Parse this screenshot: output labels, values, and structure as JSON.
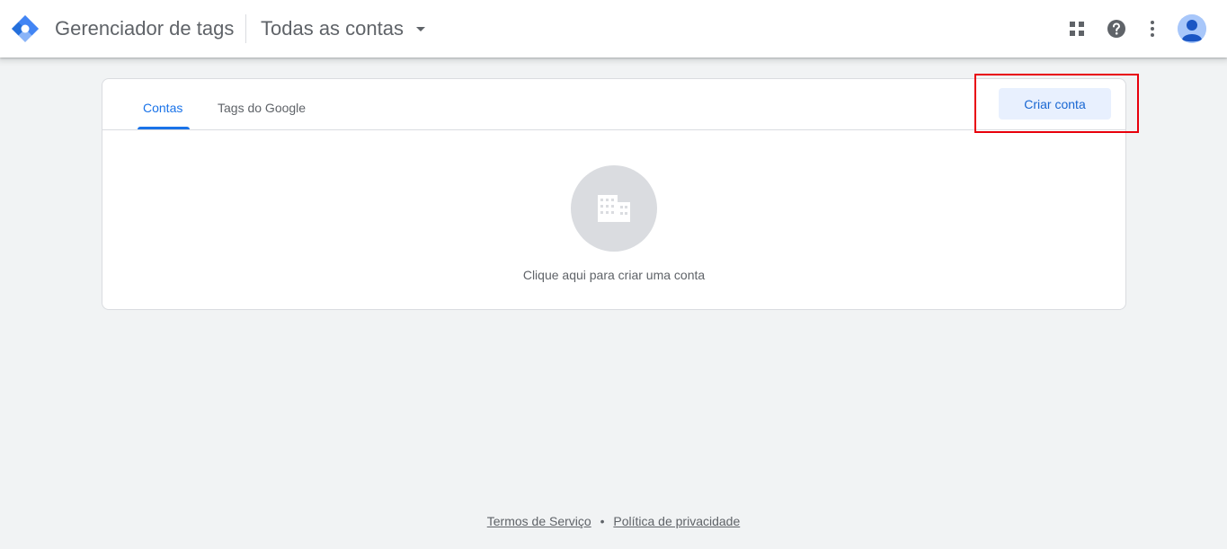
{
  "header": {
    "app_title": "Gerenciador de tags",
    "account_selector": "Todas as contas",
    "icons": [
      "apps-icon",
      "help-icon",
      "more-vert-icon",
      "avatar-icon"
    ]
  },
  "tabs": [
    {
      "label": "Contas",
      "active": true
    },
    {
      "label": "Tags do Google",
      "active": false
    }
  ],
  "actions": {
    "create_account": "Criar conta"
  },
  "empty_state": {
    "icon": "building-icon",
    "text": "Clique aqui para criar uma conta"
  },
  "footer": {
    "terms": "Termos de Serviço",
    "separator": "•",
    "privacy": "Política de privacidade"
  },
  "colors": {
    "accent": "#1a73e8",
    "highlight": "#e8000b"
  }
}
